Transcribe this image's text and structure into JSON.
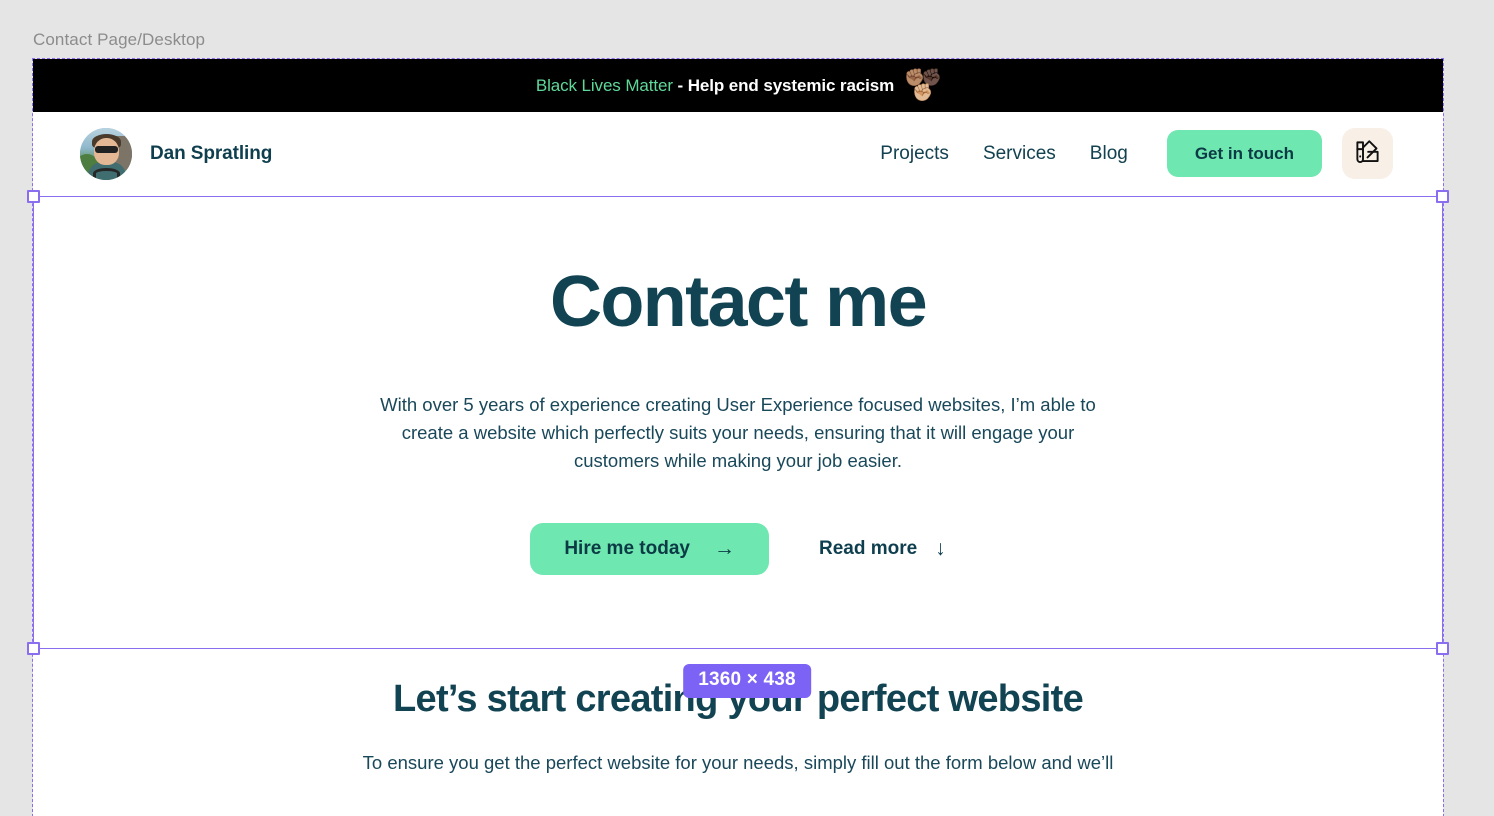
{
  "figma": {
    "frame_label": "Contact Page/Desktop",
    "selection_dimensions": "1360 × 438",
    "selection_color": "#8b6df0",
    "badge_color": "#7c63f5"
  },
  "banner": {
    "highlight_text": "Black Lives Matter",
    "rest_text": " - Help end systemic racism",
    "highlight_color": "#5fd99a",
    "background": "#000000",
    "fists": [
      "✊🏽",
      "✊🏿",
      "✊🏼"
    ]
  },
  "nav": {
    "avatar_name": "avatar",
    "brand": "Dan Spratling",
    "links": [
      {
        "label": "Projects"
      },
      {
        "label": "Services"
      },
      {
        "label": "Blog"
      }
    ],
    "cta_label": "Get in touch",
    "cta_color": "#6ee7b0",
    "theme_icon": "color-palette-swatch-icon"
  },
  "hero": {
    "title": "Contact me",
    "paragraph": "With over 5 years of experience creating User Experience focused websites, I’m able to create a website which perfectly suits your needs, ensuring that it will engage your customers while making your job easier.",
    "primary_label": "Hire me today",
    "primary_arrow": "→",
    "secondary_label": "Read more",
    "secondary_arrow": "↓",
    "heading_color": "#114352"
  },
  "section2": {
    "title": "Let’s start creating your perfect website",
    "paragraph": "To ensure you get the perfect website for your needs, simply fill out the form below and we’ll"
  }
}
